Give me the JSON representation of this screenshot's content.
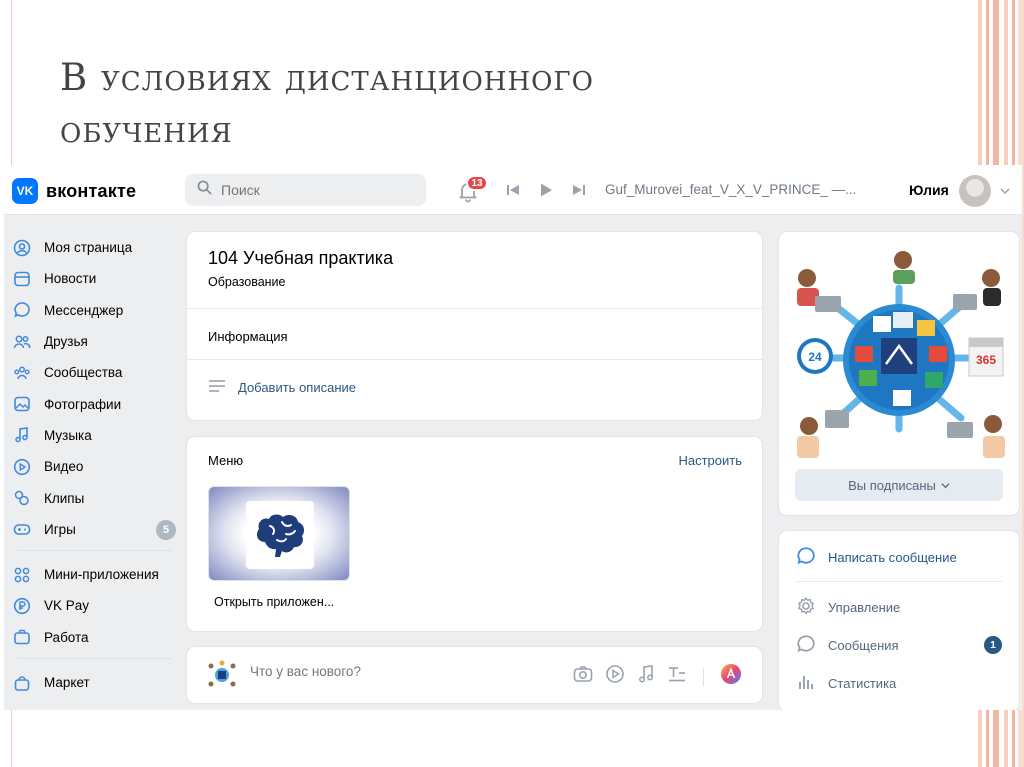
{
  "slide": {
    "title_line1": "В условиях дистанционного",
    "title_line2": "обучения"
  },
  "colors": {
    "accent": "#2a5885",
    "vk_blue": "#0077ff",
    "badge_red": "#e64646",
    "slide_stripes": "#f2b6a0"
  },
  "header": {
    "logo_text": "вконтакте",
    "logo_icon": "vk-logo-icon",
    "search_placeholder": "Поиск",
    "notifications_count": "13",
    "player_track": "Guf_Murovei_feat_V_X_V_PRINCE_ —...",
    "user_name": "Юлия"
  },
  "sidebar": {
    "items": [
      {
        "label": "Моя страница",
        "icon": "user-circle-icon"
      },
      {
        "label": "Новости",
        "icon": "news-icon"
      },
      {
        "label": "Мессенджер",
        "icon": "message-icon"
      },
      {
        "label": "Друзья",
        "icon": "friends-icon"
      },
      {
        "label": "Сообщества",
        "icon": "communities-icon"
      },
      {
        "label": "Фотографии",
        "icon": "photo-icon"
      },
      {
        "label": "Музыка",
        "icon": "music-icon"
      },
      {
        "label": "Видео",
        "icon": "video-icon"
      },
      {
        "label": "Клипы",
        "icon": "clips-icon"
      },
      {
        "label": "Игры",
        "icon": "gamepad-icon",
        "badge": "5"
      }
    ],
    "items2": [
      {
        "label": "Мини-приложения",
        "icon": "mini-apps-icon"
      },
      {
        "label": "VK Pay",
        "icon": "vkpay-icon"
      },
      {
        "label": "Работа",
        "icon": "briefcase-icon"
      }
    ],
    "items3": [
      {
        "label": "Маркет",
        "icon": "market-icon"
      }
    ]
  },
  "group": {
    "title": "104 Учебная практика",
    "category": "Образование",
    "info_label": "Информация",
    "add_description": "Добавить описание"
  },
  "menu": {
    "title": "Меню",
    "configure": "Настроить",
    "app_label": "Открыть приложен..."
  },
  "compose": {
    "placeholder": "Что у вас нового?"
  },
  "cover": {
    "subscribed_label": "Вы подписаны",
    "cover_badge_24": "24",
    "cover_badge_365": "365"
  },
  "actions": {
    "write_message": "Написать сообщение",
    "manage": "Управление",
    "messages": "Сообщения",
    "messages_count": "1",
    "statistics": "Статистика"
  }
}
